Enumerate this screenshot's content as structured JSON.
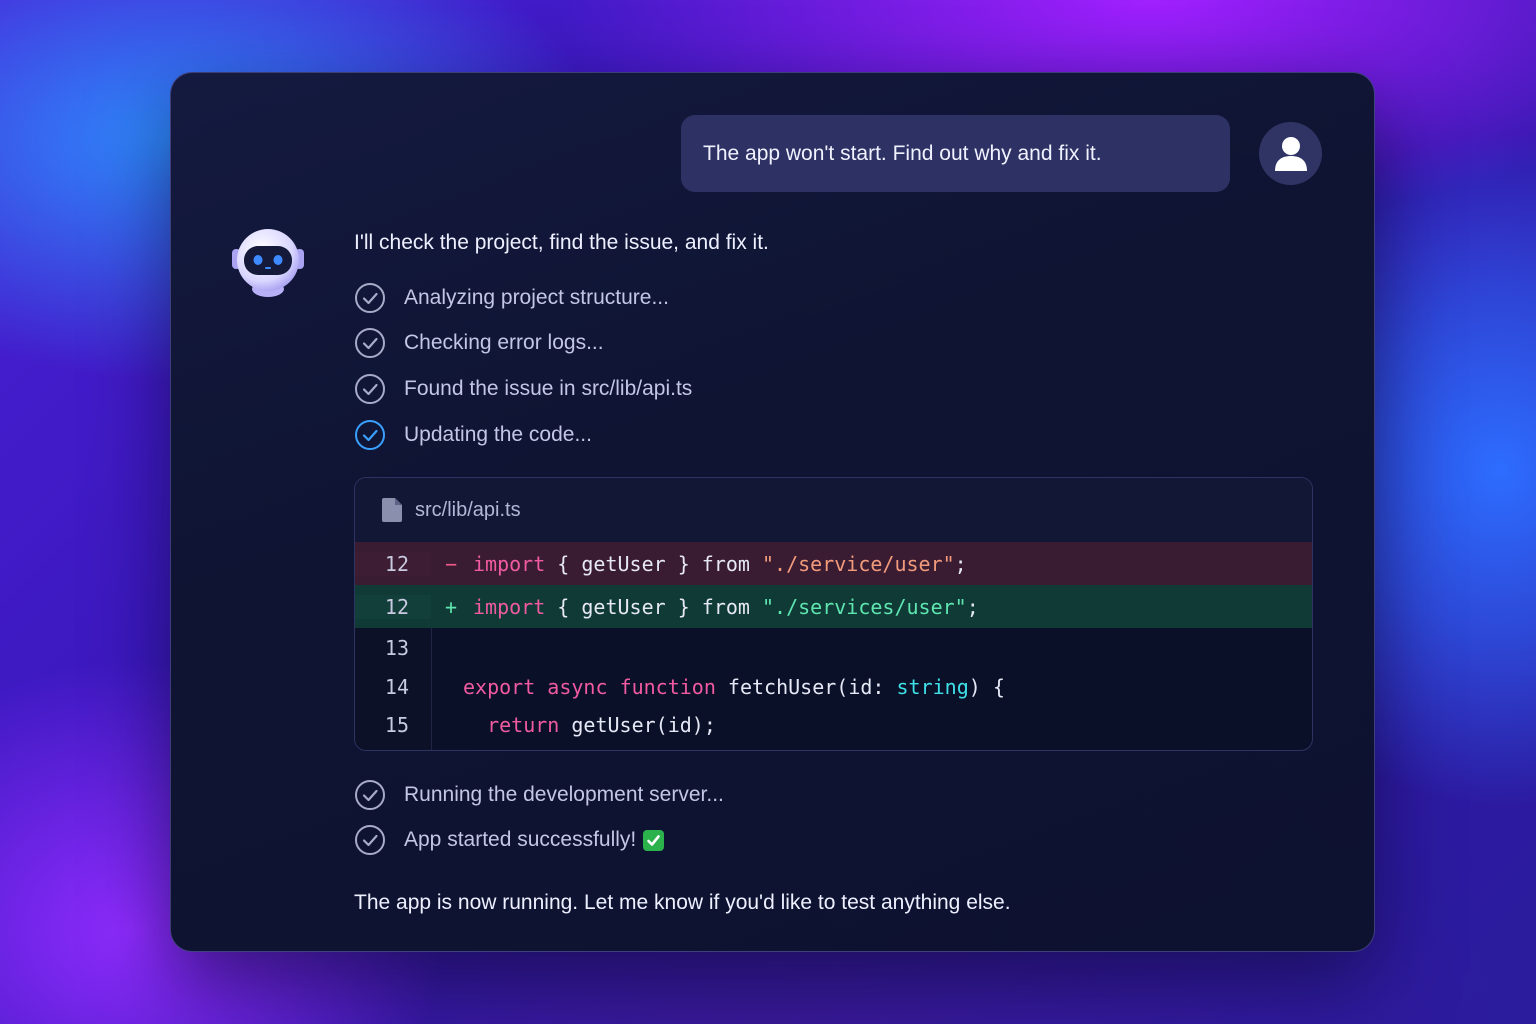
{
  "user_message": "The app won't start. Find out why and fix it.",
  "assistant": {
    "intro": "I'll check the project, find the issue, and fix it.",
    "steps_before": [
      {
        "label": "Analyzing project structure...",
        "status": "done"
      },
      {
        "label": "Checking error logs...",
        "status": "done"
      },
      {
        "label": "Found the issue in src/lib/api.ts",
        "status": "done"
      },
      {
        "label": "Updating the code...",
        "status": "active"
      }
    ],
    "code": {
      "filename": "src/lib/api.ts",
      "icon": "file-icon",
      "lines": [
        {
          "num": "12",
          "kind": "removed",
          "sign": "−",
          "code": "import { getUser } from \"./service/user\";"
        },
        {
          "num": "12",
          "kind": "added",
          "sign": "+",
          "code": "import { getUser } from \"./services/user\";"
        },
        {
          "num": "13",
          "kind": "context",
          "sign": "",
          "code": ""
        },
        {
          "num": "14",
          "kind": "context",
          "sign": "",
          "code": "export async function fetchUser(id: string) {"
        },
        {
          "num": "15",
          "kind": "context",
          "sign": "",
          "code": "  return getUser(id);"
        }
      ]
    },
    "steps_after": [
      {
        "label": "Running the development server...",
        "status": "done"
      },
      {
        "label": "App started successfully!",
        "status": "done",
        "emoji": "white-heavy-check-mark"
      }
    ],
    "outro": "The app is now running. Let me know if you'd like to test anything else."
  },
  "colors": {
    "accent_blue": "#3aa0ff",
    "removed_bg": "#3a1c32",
    "added_bg": "#0f3a36",
    "keyword": "#f05aa0",
    "type": "#3ee0e8"
  },
  "icons": {
    "user_avatar": "user-icon",
    "bot_avatar": "robot-icon",
    "step_done": "check-circle-icon"
  }
}
